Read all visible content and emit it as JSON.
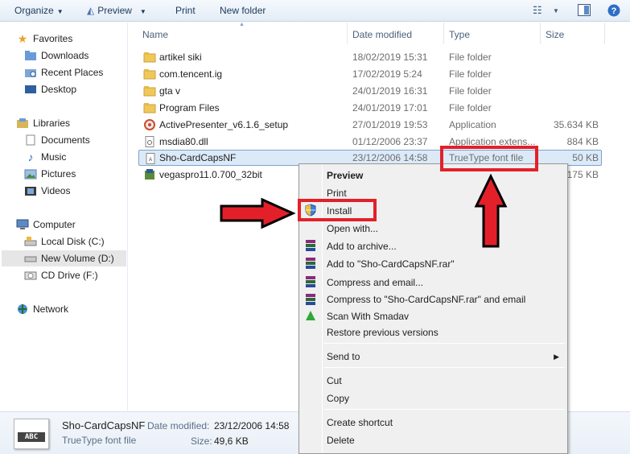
{
  "toolbar": {
    "organize": "Organize",
    "preview": "Preview",
    "print": "Print",
    "new_folder": "New folder"
  },
  "nav": {
    "favorites": "Favorites",
    "downloads": "Downloads",
    "recent_places": "Recent Places",
    "desktop": "Desktop",
    "libraries": "Libraries",
    "documents": "Documents",
    "music": "Music",
    "pictures": "Pictures",
    "videos": "Videos",
    "computer": "Computer",
    "local_disk": "Local Disk (C:)",
    "new_volume": "New Volume (D:)",
    "cd_drive": "CD Drive (F:)",
    "network": "Network"
  },
  "columns": {
    "name": "Name",
    "date": "Date modified",
    "type": "Type",
    "size": "Size"
  },
  "files": [
    {
      "name": "artikel siki",
      "date": "18/02/2019 15:31",
      "type": "File folder",
      "size": ""
    },
    {
      "name": "com.tencent.ig",
      "date": "17/02/2019 5:24",
      "type": "File folder",
      "size": ""
    },
    {
      "name": "gta v",
      "date": "24/01/2019 16:31",
      "type": "File folder",
      "size": ""
    },
    {
      "name": "Program Files",
      "date": "24/01/2019 17:01",
      "type": "File folder",
      "size": ""
    },
    {
      "name": "ActivePresenter_v6.1.6_setup",
      "date": "27/01/2019 19:53",
      "type": "Application",
      "size": "35.634 KB"
    },
    {
      "name": "msdia80.dll",
      "date": "01/12/2006 23:37",
      "type": "Application extens...",
      "size": "884 KB"
    },
    {
      "name": "Sho-CardCapsNF",
      "date": "23/12/2006 14:58",
      "type": "TrueType font file",
      "size": "50 KB"
    },
    {
      "name": "vegaspro11.0.700_32bit",
      "date": "",
      "type": "",
      "size": "3.175 KB"
    }
  ],
  "details": {
    "name": "Sho-CardCapsNF",
    "type": "TrueType font file",
    "date_label": "Date modified:",
    "date_value": "23/12/2006 14:58",
    "size_label": "Size:",
    "size_value": "49,6 KB",
    "thumb_text": "ABC"
  },
  "menu": {
    "preview": "Preview",
    "print": "Print",
    "install": "Install",
    "open_with": "Open with...",
    "add_archive": "Add to archive...",
    "add_rar": "Add to \"Sho-CardCapsNF.rar\"",
    "compress_email": "Compress and email...",
    "compress_rar_email": "Compress to \"Sho-CardCapsNF.rar\" and email",
    "scan_smadav": "Scan With Smadav",
    "restore": "Restore previous versions",
    "send_to": "Send to",
    "cut": "Cut",
    "copy": "Copy",
    "create_shortcut": "Create shortcut",
    "delete": "Delete"
  },
  "colors": {
    "highlight": "#e3202a",
    "selection": "#dceaf8",
    "folder": "#f0c85a"
  }
}
